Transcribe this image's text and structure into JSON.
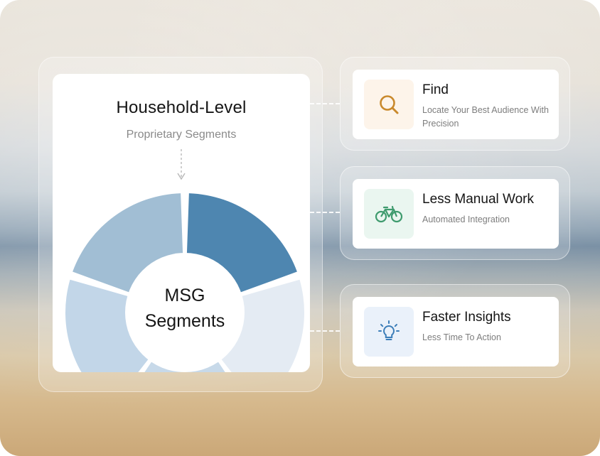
{
  "panel": {
    "title": "Household-Level",
    "subtitle": "Proprietary Segments",
    "center_line1": "MSG",
    "center_line2": "Segments",
    "segment_colors": [
      "#4e86b0",
      "#e4ebf3",
      "#c7d9e9",
      "#c2d6e8",
      "#a1bed4"
    ]
  },
  "cards": [
    {
      "title": "Find",
      "desc": "Locate Your Best Audience With Precision",
      "icon": "search-icon",
      "icon_bg": "#fdf4ea",
      "icon_color": "#c9892c"
    },
    {
      "title": "Less Manual Work",
      "desc": "Automated Integration",
      "icon": "bicycle-icon",
      "icon_bg": "#eaf6f0",
      "icon_color": "#3f9b6e"
    },
    {
      "title": "Faster Insights",
      "desc": "Less Time To Action",
      "icon": "lightbulb-icon",
      "icon_bg": "#eaf1fa",
      "icon_color": "#3b7db8"
    }
  ]
}
